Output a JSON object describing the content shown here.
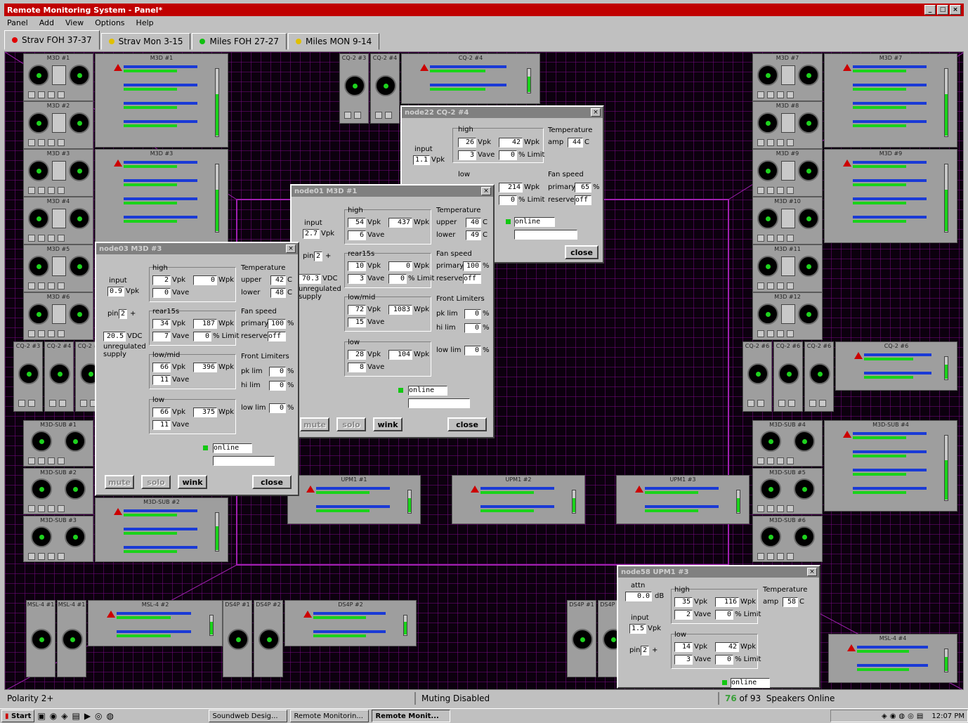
{
  "window": {
    "title": "Remote Monitoring System - Panel*"
  },
  "menu": [
    "Panel",
    "Add",
    "View",
    "Options",
    "Help"
  ],
  "tabs": [
    {
      "label": "Strav FOH  37-37",
      "color": "#e00000"
    },
    {
      "label": "Strav Mon  3-15",
      "color": "#e0c000"
    },
    {
      "label": "Miles FOH  27-27",
      "color": "#10c010"
    },
    {
      "label": "Miles MON  9-14",
      "color": "#e0c000"
    }
  ],
  "nodes": {
    "m3d1": "M3D #1",
    "m3d2": "M3D #2",
    "m3d3": "M3D #3",
    "m3d4": "M3D #4",
    "m3d5": "M3D #5",
    "m3d6": "M3D #6",
    "m3d7": "M3D #7",
    "m3d8": "M3D #8",
    "m3d9": "M3D #9",
    "m3d10": "M3D #10",
    "m3d11": "M3D #11",
    "m3d12": "M3D #12",
    "cq1": "CQ-2 #3",
    "cq2": "CQ-2 #4",
    "cq3": "CQ-2 #4",
    "cq5": "CQ-2 #6",
    "sub1": "M3D-SUB #1",
    "sub2": "M3D-SUB #2",
    "sub3": "M3D-SUB #3",
    "sub4": "M3D-SUB #4",
    "sub5": "M3D-SUB #5",
    "sub6": "M3D-SUB #6",
    "upm1": "UPM1 #1",
    "upm2": "UPM1 #2",
    "upm3": "UPM1 #3",
    "msl1": "MSL-4 #1",
    "msl2": "MSL-4 #2",
    "msl3": "MSL-4 #4",
    "ds1": "DS4P #1",
    "ds2": "DS4P #2",
    "ds3": "DS4P #2"
  },
  "dialogs": {
    "node22": {
      "title": "node22  CQ-2 #4",
      "high_label": "high",
      "high_vpk": "26",
      "high_wpk": "42",
      "high_vave": "3",
      "high_limit": "0",
      "low_label": "low",
      "low_wpk": "214",
      "low_limit": "0",
      "input_label": "input",
      "input_vpk": "1.1",
      "pin": "2",
      "temp_label": "Temperature",
      "amp_label": "amp",
      "amp_c": "44",
      "fan_label": "Fan speed",
      "primary_label": "primary",
      "primary_val": "65",
      "reserve_label": "reserve",
      "reserve_val": "off",
      "status": "online",
      "close": "close"
    },
    "node01": {
      "title": "node01  M3D #1",
      "input_label": "input",
      "input_vpk": "2.7",
      "pin": "2",
      "supply_vdc": "70.3",
      "supply_label": "unregulated supply",
      "high_vpk": "54",
      "high_wpk": "437",
      "high_vave": "6",
      "rear_vpk": "10",
      "rear_wpk": "0",
      "rear_vave": "3",
      "rear_limit": "0",
      "lowmid_vpk": "72",
      "lowmid_wpk": "1083",
      "lowmid_vave": "15",
      "low_vpk": "28",
      "low_wpk": "104",
      "low_vave": "8",
      "upper_c": "40",
      "lower_c": "49",
      "primary_val": "100",
      "reserve_val": "off",
      "pklim": "0",
      "hilim": "0",
      "lowlim": "0",
      "status": "online",
      "mute": "mute",
      "solo": "solo",
      "wink": "wink",
      "close": "close"
    },
    "node03": {
      "title": "node03  M3D #3",
      "input_label": "input",
      "input_vpk": "0.9",
      "pin": "2",
      "supply_vdc": "20.5",
      "supply_label": "unregulated supply",
      "high_vpk": "2",
      "high_wpk": "0",
      "high_vave": "0",
      "rear_vpk": "34",
      "rear_wpk": "187",
      "rear_vave": "7",
      "rear_limit": "0",
      "lowmid_vpk": "66",
      "lowmid_wpk": "396",
      "lowmid_vave": "11",
      "low_vpk": "66",
      "low_wpk": "375",
      "low_vave": "11",
      "upper_c": "42",
      "lower_c": "48",
      "primary_val": "100",
      "reserve_val": "off",
      "pklim": "0",
      "hilim": "0",
      "lowlim": "0",
      "status": "online",
      "mute": "mute",
      "solo": "solo",
      "wink": "wink",
      "close": "close"
    },
    "node58": {
      "title": "node58  UPM1 #3",
      "attn_label": "attn",
      "attn_val": "0.0",
      "attn_unit": "dB",
      "input_label": "input",
      "input_vpk": "1.5",
      "pin": "2",
      "high_vpk": "35",
      "high_wpk": "116",
      "high_vave": "2",
      "high_limit": "0",
      "low_vpk": "14",
      "low_wpk": "42",
      "low_vave": "3",
      "low_limit": "0",
      "amp_c": "58",
      "status": "online"
    }
  },
  "labels": {
    "high": "high",
    "low": "low",
    "rear15": "rear15s",
    "lowmid": "low/mid",
    "vpk": "Vpk",
    "wpk": "Wpk",
    "vave": "Vave",
    "limit": "% Limit",
    "vdc": "VDC",
    "temperature": "Temperature",
    "upper": "upper",
    "lower": "lower",
    "amp": "amp",
    "fan": "Fan speed",
    "primary": "primary",
    "reserve": "reserve",
    "pct": "%",
    "c": "C",
    "front_limiters": "Front Limiters",
    "pklim": "pk lim",
    "hilim": "hi lim",
    "lowlim": "low lim",
    "pin": "pin",
    "plus": "+"
  },
  "status": {
    "polarity": "Polarity  2+",
    "muting": "Muting Disabled",
    "online_count": "76",
    "online_text": " of 93  Speakers Online"
  },
  "taskbar": {
    "start": "Start",
    "items": [
      "Soundweb Desig...",
      "Remote Monitorin...",
      "Remote Monit..."
    ],
    "clock": "12:07 PM"
  }
}
